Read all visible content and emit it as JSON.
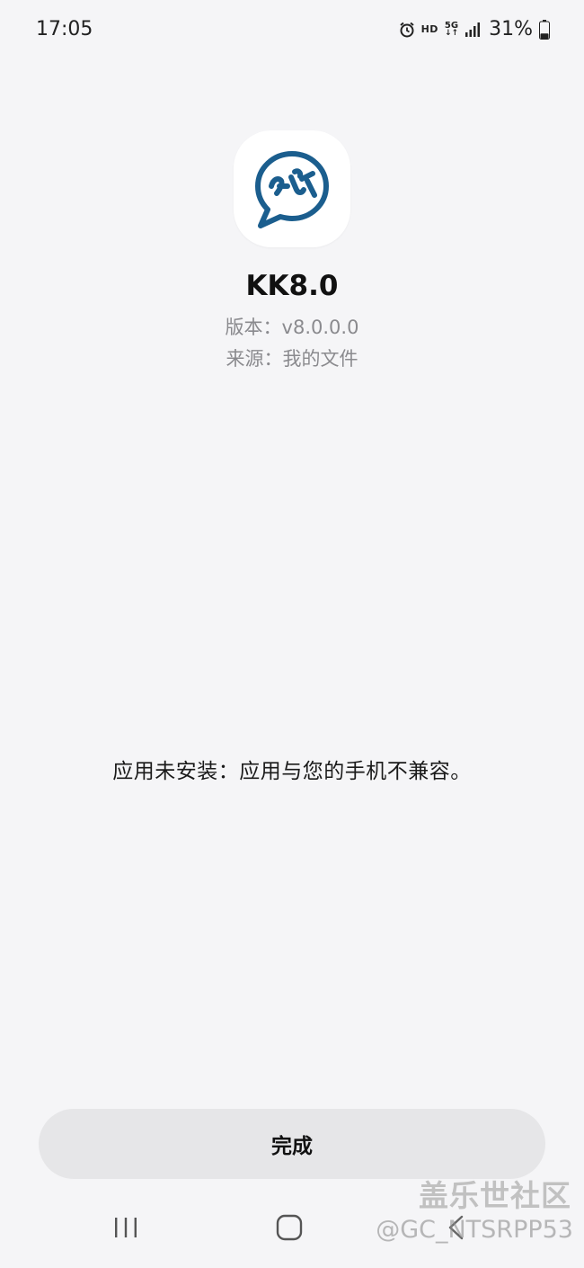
{
  "status_bar": {
    "time": "17:05",
    "hd_label": "HD",
    "network_label": "5G",
    "network_arrows": "↓↑",
    "battery_percent": "31%",
    "battery_level": 0.31,
    "icons": [
      "alarm-icon",
      "signal-icon",
      "battery-icon"
    ]
  },
  "app": {
    "name": "KK8.0",
    "version_line": "版本：v8.0.0.0",
    "source_line": "来源：我的文件",
    "icon": "kk-chat-bubble-logo",
    "icon_color": "#1b5e8e"
  },
  "message": "应用未安装：应用与您的手机不兼容。",
  "actions": {
    "done_label": "完成"
  },
  "navigation": {
    "icons": [
      "recents-icon",
      "home-icon",
      "back-icon"
    ]
  },
  "watermark": {
    "brand": "盖乐世社区",
    "user": "@GC_NTSRPP53"
  }
}
